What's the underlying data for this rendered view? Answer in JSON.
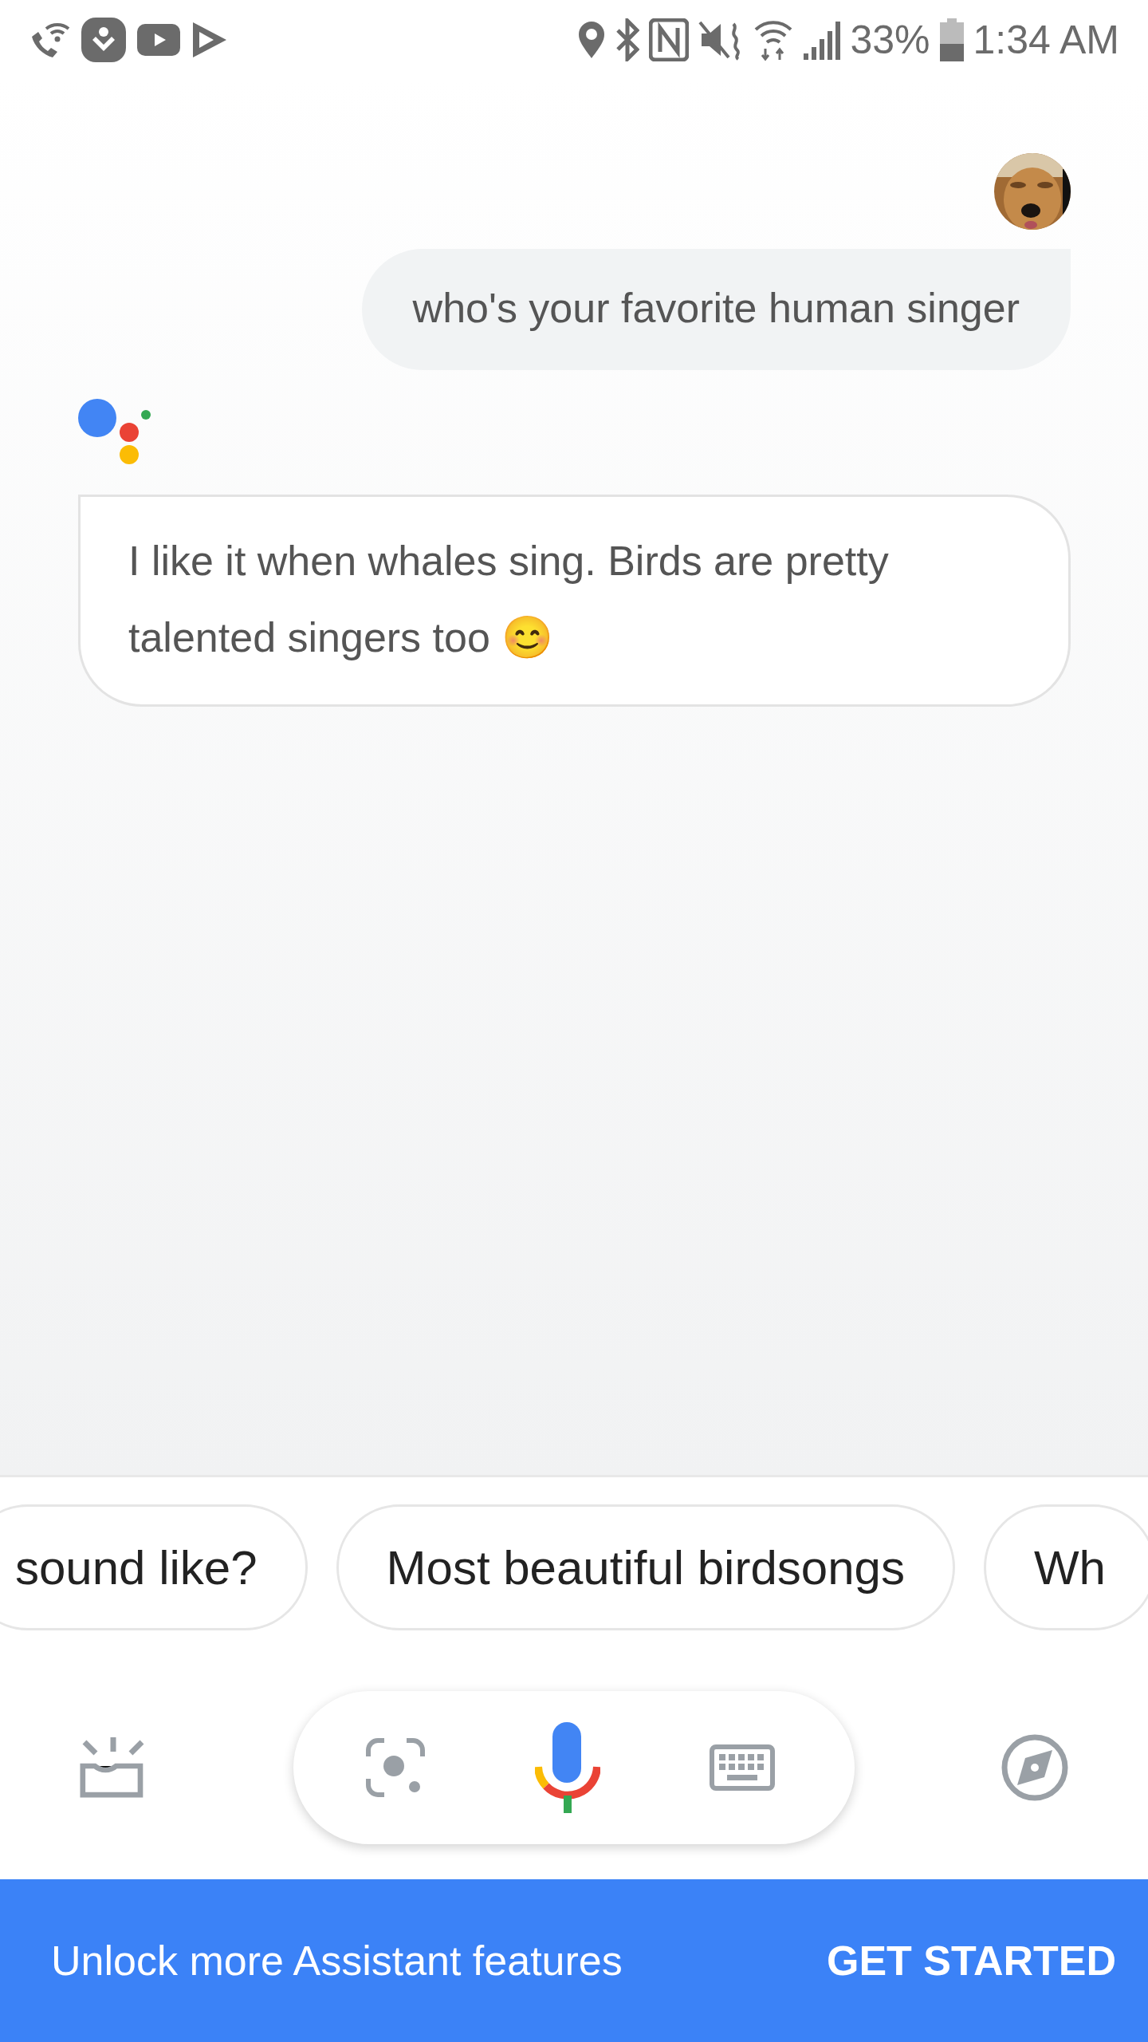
{
  "status_bar": {
    "battery": "33%",
    "time": "1:34 AM"
  },
  "conversation": [
    {
      "kind": "user",
      "text": "who's your favorite human singer"
    },
    {
      "kind": "assistant",
      "text": "I like it when whales sing. Birds are pretty talented singers too 😊"
    }
  ],
  "suggestions": [
    "sound like?",
    "Most beautiful birdsongs",
    "Wh"
  ],
  "banner": {
    "text": "Unlock more Assistant features",
    "action": "GET STARTED"
  }
}
